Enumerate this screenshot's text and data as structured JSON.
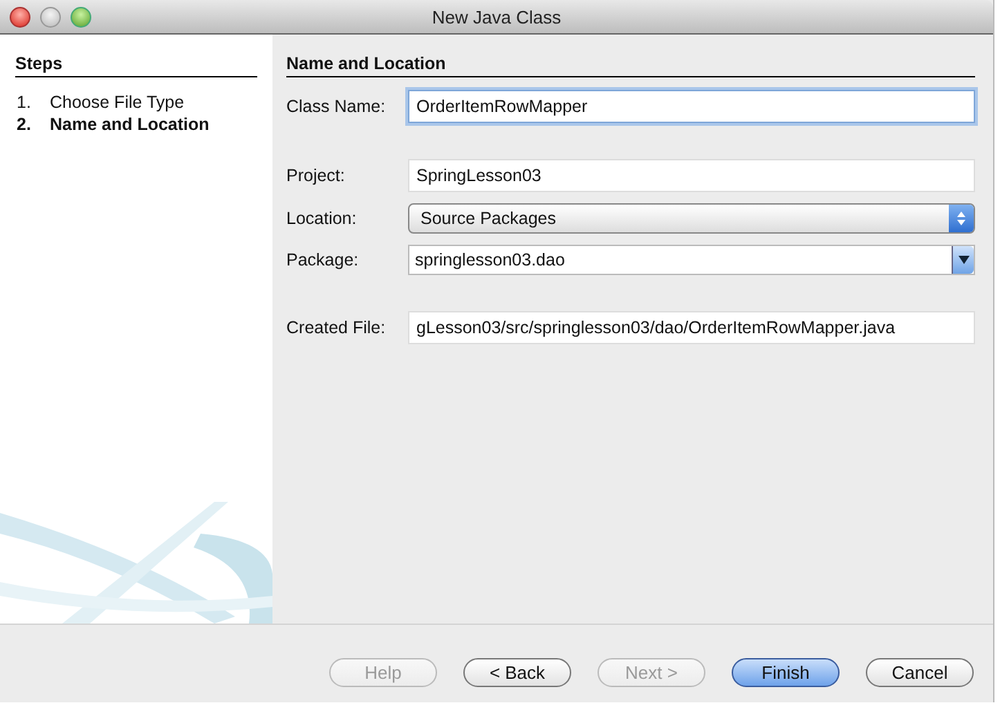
{
  "window": {
    "title": "New Java Class"
  },
  "steps": {
    "heading": "Steps",
    "items": [
      {
        "number": "1.",
        "label": "Choose File Type",
        "selected": false
      },
      {
        "number": "2.",
        "label": "Name and Location",
        "selected": true
      }
    ]
  },
  "panel": {
    "heading": "Name and Location",
    "fields": [
      {
        "kind": "text",
        "label": "Class Name:",
        "value": "OrderItemRowMapper",
        "focused": true
      },
      {
        "kind": "gap"
      },
      {
        "kind": "text",
        "label": "Project:",
        "value": "SpringLesson03",
        "focused": false
      },
      {
        "kind": "popup",
        "label": "Location:",
        "value": "Source Packages"
      },
      {
        "kind": "combo",
        "label": "Package:",
        "value": "springlesson03.dao"
      },
      {
        "kind": "gap"
      },
      {
        "kind": "text",
        "label": "Created File:",
        "value": "gLesson03/src/springlesson03/dao/OrderItemRowMapper.java",
        "focused": false
      }
    ]
  },
  "buttons": [
    {
      "label": "Help",
      "disabled": true,
      "default": false
    },
    {
      "label": "< Back",
      "disabled": false,
      "default": false
    },
    {
      "label": "Next >",
      "disabled": true,
      "default": false
    },
    {
      "label": "Finish",
      "disabled": false,
      "default": true
    },
    {
      "label": "Cancel",
      "disabled": false,
      "default": false
    }
  ]
}
